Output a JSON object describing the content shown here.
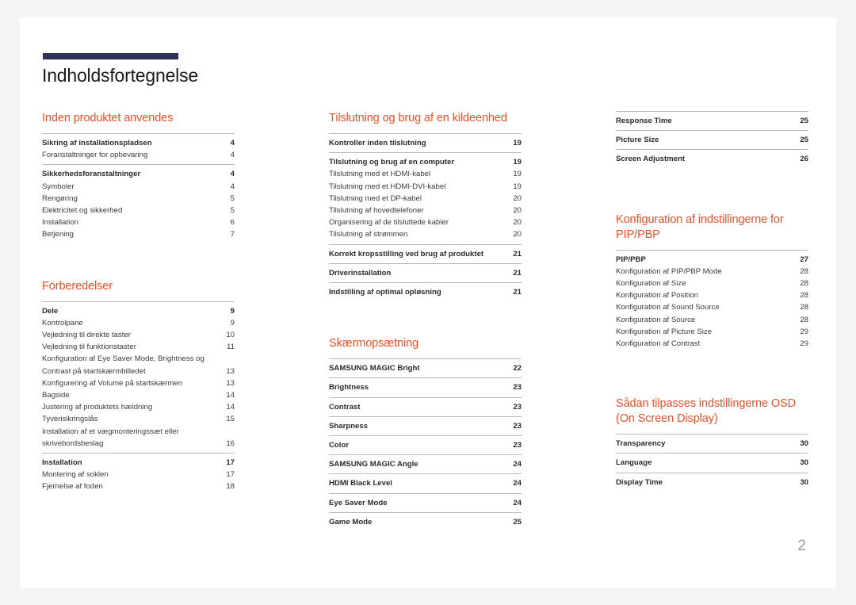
{
  "document": {
    "title": "Indholdsfortegnelse",
    "page_number": "2",
    "accent_color": "#2b3350",
    "header_color": "#e8512a"
  },
  "columns": [
    {
      "sections": [
        {
          "header": "Inden produktet anvendes",
          "groups": [
            {
              "entries": [
                {
                  "label": "Sikring af installationspladsen",
                  "page": "4",
                  "bold": true
                },
                {
                  "label": "Foranstaltninger for opbevaring",
                  "page": "4",
                  "bold": false
                }
              ]
            },
            {
              "entries": [
                {
                  "label": "Sikkerhedsforanstaltninger",
                  "page": "4",
                  "bold": true
                },
                {
                  "label": "Symboler",
                  "page": "4",
                  "bold": false
                },
                {
                  "label": "Rengøring",
                  "page": "5",
                  "bold": false
                },
                {
                  "label": "Elektricitet og sikkerhed",
                  "page": "5",
                  "bold": false
                },
                {
                  "label": "Installation",
                  "page": "6",
                  "bold": false
                },
                {
                  "label": "Betjening",
                  "page": "7",
                  "bold": false
                }
              ]
            }
          ]
        },
        {
          "header": "Forberedelser",
          "groups": [
            {
              "entries": [
                {
                  "label": "Dele",
                  "page": "9",
                  "bold": true
                },
                {
                  "label": "Kontrolpane",
                  "page": "9",
                  "bold": false
                },
                {
                  "label": "Vejledning til direkte taster",
                  "page": "10",
                  "bold": false
                },
                {
                  "label": "Vejledning til funktionstaster",
                  "page": "11",
                  "bold": false
                },
                {
                  "label": "Konfiguration af Eye Saver Mode, Brightness og Contrast på startskærmbilledet",
                  "page": "13",
                  "bold": false
                },
                {
                  "label": "Konfigurering af Volume på startskærmen",
                  "page": "13",
                  "bold": false
                },
                {
                  "label": "Bagside",
                  "page": "14",
                  "bold": false
                },
                {
                  "label": "Justering af produktets hældning",
                  "page": "14",
                  "bold": false
                },
                {
                  "label": "Tyverisikringslås",
                  "page": "15",
                  "bold": false
                },
                {
                  "label": "Installation af et vægmonteringssæt eller skrivebordsbeslag",
                  "page": "16",
                  "bold": false
                }
              ]
            },
            {
              "entries": [
                {
                  "label": "Installation",
                  "page": "17",
                  "bold": true
                },
                {
                  "label": "Montering af soklen",
                  "page": "17",
                  "bold": false
                },
                {
                  "label": "Fjernelse af foden",
                  "page": "18",
                  "bold": false
                }
              ]
            }
          ]
        }
      ]
    },
    {
      "sections": [
        {
          "header": "Tilslutning og brug af en kildeenhed",
          "groups": [
            {
              "entries": [
                {
                  "label": "Kontroller inden tilslutning",
                  "page": "19",
                  "bold": true
                }
              ]
            },
            {
              "entries": [
                {
                  "label": "Tilslutning og brug af en computer",
                  "page": "19",
                  "bold": true
                },
                {
                  "label": "Tilslutning med et HDMI-kabel",
                  "page": "19",
                  "bold": false
                },
                {
                  "label": "Tilslutning med et HDMI-DVI-kabel",
                  "page": "19",
                  "bold": false
                },
                {
                  "label": "Tilslutning med et DP-kabel",
                  "page": "20",
                  "bold": false
                },
                {
                  "label": "Tilslutning af hovedtelefoner",
                  "page": "20",
                  "bold": false
                },
                {
                  "label": "Organisering af de tilsluttede kabler",
                  "page": "20",
                  "bold": false
                },
                {
                  "label": "Tilslutning af strømmen",
                  "page": "20",
                  "bold": false
                }
              ]
            },
            {
              "entries": [
                {
                  "label": "Korrekt kropsstilling ved brug af produktet",
                  "page": "21",
                  "bold": true
                }
              ]
            },
            {
              "entries": [
                {
                  "label": "Driverinstallation",
                  "page": "21",
                  "bold": true
                }
              ]
            },
            {
              "entries": [
                {
                  "label": "Indstilling af optimal opløsning",
                  "page": "21",
                  "bold": true
                }
              ]
            }
          ]
        },
        {
          "header": "Skærmopsætning",
          "groups": [
            {
              "entries": [
                {
                  "label": "SAMSUNG MAGIC Bright",
                  "page": "22",
                  "bold": true
                }
              ]
            },
            {
              "entries": [
                {
                  "label": "Brightness",
                  "page": "23",
                  "bold": true
                }
              ]
            },
            {
              "entries": [
                {
                  "label": "Contrast",
                  "page": "23",
                  "bold": true
                }
              ]
            },
            {
              "entries": [
                {
                  "label": "Sharpness",
                  "page": "23",
                  "bold": true
                }
              ]
            },
            {
              "entries": [
                {
                  "label": "Color",
                  "page": "23",
                  "bold": true
                }
              ]
            },
            {
              "entries": [
                {
                  "label": "SAMSUNG MAGIC Angle",
                  "page": "24",
                  "bold": true
                }
              ]
            },
            {
              "entries": [
                {
                  "label": "HDMI Black Level",
                  "page": "24",
                  "bold": true
                }
              ]
            },
            {
              "entries": [
                {
                  "label": "Eye Saver Mode",
                  "page": "24",
                  "bold": true
                }
              ]
            },
            {
              "entries": [
                {
                  "label": "Game Mode",
                  "page": "25",
                  "bold": true
                }
              ]
            }
          ]
        }
      ]
    },
    {
      "sections": [
        {
          "header": "",
          "groups": [
            {
              "entries": [
                {
                  "label": "Response Time",
                  "page": "25",
                  "bold": true
                }
              ]
            },
            {
              "entries": [
                {
                  "label": "Picture Size",
                  "page": "25",
                  "bold": true
                }
              ]
            },
            {
              "entries": [
                {
                  "label": "Screen Adjustment",
                  "page": "26",
                  "bold": true
                }
              ]
            }
          ]
        },
        {
          "header": "Konfiguration af indstillingerne for PIP/PBP",
          "groups": [
            {
              "entries": [
                {
                  "label": "PIP/PBP",
                  "page": "27",
                  "bold": true
                },
                {
                  "label": "Konfiguration af PIP/PBP Mode",
                  "page": "28",
                  "bold": false
                },
                {
                  "label": "Konfiguration af Size",
                  "page": "28",
                  "bold": false
                },
                {
                  "label": "Konfiguration af Position",
                  "page": "28",
                  "bold": false
                },
                {
                  "label": "Konfiguration af Sound Source",
                  "page": "28",
                  "bold": false
                },
                {
                  "label": "Konfiguration af Source",
                  "page": "28",
                  "bold": false
                },
                {
                  "label": "Konfiguration af Picture Size",
                  "page": "29",
                  "bold": false
                },
                {
                  "label": "Konfiguration af Contrast",
                  "page": "29",
                  "bold": false
                }
              ]
            }
          ]
        },
        {
          "header": "Sådan tilpasses indstillingerne OSD (On Screen Display)",
          "groups": [
            {
              "entries": [
                {
                  "label": "Transparency",
                  "page": "30",
                  "bold": true
                }
              ]
            },
            {
              "entries": [
                {
                  "label": "Language",
                  "page": "30",
                  "bold": true
                }
              ]
            },
            {
              "entries": [
                {
                  "label": "Display Time",
                  "page": "30",
                  "bold": true
                }
              ]
            }
          ]
        }
      ]
    }
  ]
}
